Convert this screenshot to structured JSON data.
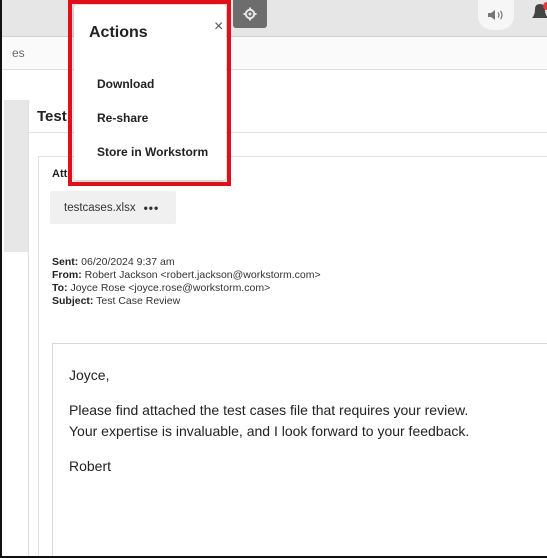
{
  "subbar": {
    "tab_text": "es"
  },
  "topbar": {
    "settings_icon": "gear-icon",
    "volume_icon": "volume-icon",
    "notification_icon": "bell-icon",
    "badge_color": "#e23b3b"
  },
  "pane": {
    "title": "Test"
  },
  "card": {
    "attachments_label": "Att",
    "attachment": {
      "filename": "testcases.xlsx",
      "more_label": "•••"
    },
    "meta": {
      "sent_label": "Sent:",
      "sent_value": "06/20/2024 9:37 am",
      "from_label": "From:",
      "from_value": "Robert Jackson <robert.jackson@workstorm.com>",
      "to_label": "To:",
      "to_value": "Joyce Rose <joyce.rose@workstorm.com>",
      "subject_label": "Subject:",
      "subject_value": "Test Case Review"
    },
    "body": {
      "greeting": "Joyce,",
      "line1": "Please find attached the test cases file that requires your review.",
      "line2": "Your expertise is invaluable, and I look forward to your feedback.",
      "signature": "Robert"
    }
  },
  "actions_popup": {
    "title": "Actions",
    "close_label": "×",
    "items": [
      {
        "label": "Download"
      },
      {
        "label": "Re-share"
      },
      {
        "label": "Store in Workstorm"
      }
    ],
    "highlight_color": "#e0101b"
  }
}
